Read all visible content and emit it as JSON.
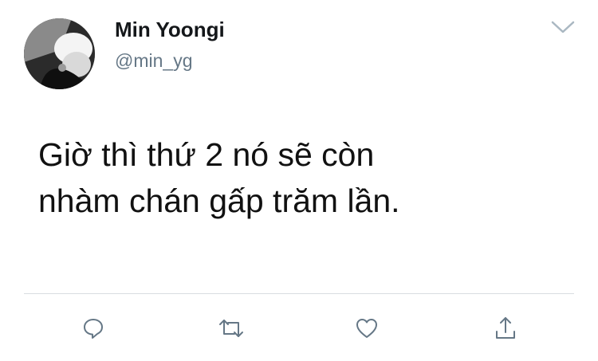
{
  "tweet": {
    "author": {
      "display_name": "Min Yoongi",
      "handle": "@min_yg",
      "avatar_icon": "profile-photo"
    },
    "menu_icon": "chevron-down-icon",
    "text_lines": [
      "Giờ thì thứ 2 nó sẽ còn",
      "nhàm chán gấp trăm lần."
    ],
    "actions": [
      {
        "name": "reply",
        "icon": "reply-icon"
      },
      {
        "name": "retweet",
        "icon": "retweet-icon"
      },
      {
        "name": "like",
        "icon": "heart-icon"
      },
      {
        "name": "share",
        "icon": "share-icon"
      }
    ],
    "colors": {
      "text": "#14171a",
      "secondary": "#657786",
      "icon": "#657786",
      "divider": "#d8dde1"
    }
  }
}
